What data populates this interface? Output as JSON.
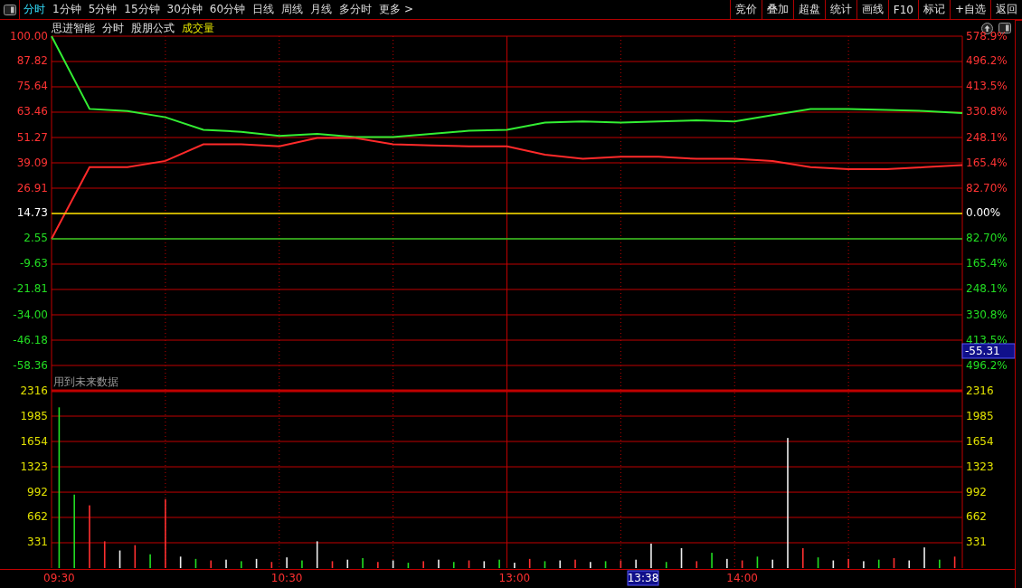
{
  "toolbar": {
    "tabs": [
      {
        "label": "分时",
        "selected": true
      },
      {
        "label": "1分钟",
        "selected": false
      },
      {
        "label": "5分钟",
        "selected": false
      },
      {
        "label": "15分钟",
        "selected": false
      },
      {
        "label": "30分钟",
        "selected": false
      },
      {
        "label": "60分钟",
        "selected": false
      },
      {
        "label": "日线",
        "selected": false
      },
      {
        "label": "周线",
        "selected": false
      },
      {
        "label": "月线",
        "selected": false
      },
      {
        "label": "多分时",
        "selected": false
      },
      {
        "label": "更多 >",
        "selected": false
      }
    ],
    "buttons": [
      "竞价",
      "叠加",
      "超盘",
      "统计",
      "画线",
      "F10",
      "标记",
      "+自选",
      "返回"
    ]
  },
  "info": {
    "stock": "思进智能",
    "mode": "分时",
    "formula": "股朋公式",
    "indicator": "成交量"
  },
  "price_chart": {
    "right_labels": [
      "578.9%",
      "496.2%",
      "413.5%",
      "330.8%",
      "248.1%",
      "165.4%",
      "82.70%",
      "0.00%",
      "82.70%",
      "165.4%",
      "248.1%",
      "330.8%",
      "413.5%",
      "496.2%"
    ],
    "cursor_value": "-55.31",
    "chart_data": {
      "type": "line",
      "grid": true,
      "ylim": [
        -58.36,
        100
      ],
      "yticks": [
        {
          "value": 100,
          "label": "100.00"
        },
        {
          "value": 87.82,
          "label": "87.82"
        },
        {
          "value": 75.64,
          "label": "75.64"
        },
        {
          "value": 63.46,
          "label": "63.46"
        },
        {
          "value": 51.27,
          "label": "51.27"
        },
        {
          "value": 39.09,
          "label": "39.09"
        },
        {
          "value": 26.91,
          "label": "26.91"
        },
        {
          "value": 14.73,
          "label": "14.73"
        },
        {
          "value": 2.55,
          "label": "2.55"
        },
        {
          "value": -9.63,
          "label": "-9.63"
        },
        {
          "value": -21.81,
          "label": "-21.81"
        },
        {
          "value": -34,
          "label": "-34.00"
        },
        {
          "value": -46.18,
          "label": "-46.18"
        },
        {
          "value": -58.36,
          "label": "-58.36"
        }
      ],
      "categories": [
        null,
        null,
        null,
        null,
        null,
        null,
        null,
        null,
        null,
        null,
        null,
        null,
        null,
        null,
        null,
        null,
        null,
        null,
        null,
        null,
        null,
        null,
        null,
        null,
        null
      ],
      "series": [
        {
          "color": "#33ee33",
          "values": [
            100,
            65,
            64,
            61,
            55,
            54,
            52,
            53,
            51.5,
            51.5,
            53,
            54.5,
            55,
            58.5,
            59,
            58.5,
            59,
            59.5,
            59,
            62,
            65,
            65,
            64.5,
            64,
            63
          ]
        },
        {
          "color": "#ff2a2a",
          "values": [
            2.55,
            37,
            37,
            40,
            48,
            48,
            47,
            51,
            51,
            48,
            47.5,
            47,
            47,
            43,
            41,
            42,
            42,
            41,
            41,
            40,
            37,
            36,
            36,
            37,
            38
          ]
        },
        {
          "color": "#e8e800",
          "values": [
            14.73,
            14.73,
            14.73,
            14.73,
            14.73,
            14.73,
            14.73,
            14.73,
            14.73,
            14.73,
            14.73,
            14.73,
            14.73,
            14.73,
            14.73,
            14.73,
            14.73,
            14.73,
            14.73,
            14.73,
            14.73,
            14.73,
            14.73,
            14.73,
            14.73
          ]
        },
        {
          "color": "#22cc22",
          "values": [
            2.55,
            2.55,
            2.55,
            2.55,
            2.55,
            2.55,
            2.55,
            2.55,
            2.55,
            2.55,
            2.55,
            2.55,
            2.55,
            2.55,
            2.55,
            2.55,
            2.55,
            2.55,
            2.55,
            2.55,
            2.55,
            2.55,
            2.55,
            2.55,
            2.55
          ]
        }
      ]
    }
  },
  "volume_chart": {
    "cursor_time": "13:38",
    "right_labels": [
      "2316",
      "1985",
      "1654",
      "1323",
      "992",
      "662",
      "331"
    ],
    "chart_data": {
      "type": "bar",
      "title": "用到未来数据",
      "grid": true,
      "stacked": true,
      "ylim": [
        0,
        2316
      ],
      "yticks": [
        {
          "value": 2316,
          "label": "2316"
        },
        {
          "value": 1985,
          "label": "1985"
        },
        {
          "value": 1654,
          "label": "1654"
        },
        {
          "value": 1323,
          "label": "1323"
        },
        {
          "value": 992,
          "label": "992"
        },
        {
          "value": 662,
          "label": "662"
        },
        {
          "value": 331,
          "label": "331"
        }
      ],
      "categories": [
        "09:30",
        null,
        null,
        null,
        null,
        null,
        null,
        null,
        null,
        null,
        null,
        null,
        null,
        null,
        null,
        "10:30",
        null,
        null,
        null,
        null,
        null,
        null,
        null,
        null,
        null,
        null,
        null,
        null,
        null,
        null,
        "13:00",
        null,
        null,
        null,
        null,
        null,
        null,
        null,
        null,
        null,
        null,
        null,
        null,
        null,
        null,
        "14:00",
        null,
        null,
        null,
        null,
        null,
        null,
        null,
        null,
        null,
        null,
        null,
        null,
        null,
        null
      ],
      "series": [
        {
          "color": "#ff3030",
          "values": [
            null,
            null,
            820,
            350,
            null,
            300,
            null,
            900,
            null,
            null,
            100,
            null,
            null,
            null,
            80,
            null,
            null,
            null,
            90,
            null,
            null,
            80,
            null,
            null,
            90,
            null,
            null,
            100,
            null,
            null,
            null,
            120,
            null,
            null,
            110,
            null,
            null,
            100,
            null,
            null,
            null,
            null,
            90,
            null,
            null,
            100,
            null,
            null,
            null,
            260,
            null,
            null,
            120,
            null,
            null,
            130,
            null,
            null,
            null,
            150
          ]
        },
        {
          "color": "#22dd22",
          "values": [
            2100,
            960,
            null,
            null,
            null,
            null,
            180,
            null,
            null,
            120,
            null,
            null,
            90,
            null,
            null,
            null,
            100,
            null,
            null,
            null,
            130,
            null,
            null,
            70,
            null,
            null,
            80,
            null,
            null,
            110,
            null,
            null,
            90,
            null,
            null,
            null,
            90,
            null,
            null,
            null,
            80,
            null,
            null,
            200,
            null,
            null,
            150,
            null,
            null,
            null,
            140,
            null,
            null,
            null,
            110,
            null,
            null,
            null,
            110,
            null
          ]
        },
        {
          "color": "#eeeeee",
          "values": [
            null,
            null,
            null,
            null,
            230,
            null,
            null,
            null,
            150,
            null,
            null,
            110,
            null,
            120,
            null,
            140,
            null,
            350,
            null,
            110,
            null,
            null,
            100,
            null,
            null,
            110,
            null,
            null,
            90,
            null,
            70,
            null,
            null,
            100,
            null,
            80,
            null,
            null,
            110,
            320,
            null,
            260,
            null,
            null,
            120,
            null,
            null,
            110,
            1700,
            null,
            null,
            100,
            null,
            90,
            null,
            null,
            100,
            270,
            null,
            null
          ]
        }
      ]
    }
  }
}
